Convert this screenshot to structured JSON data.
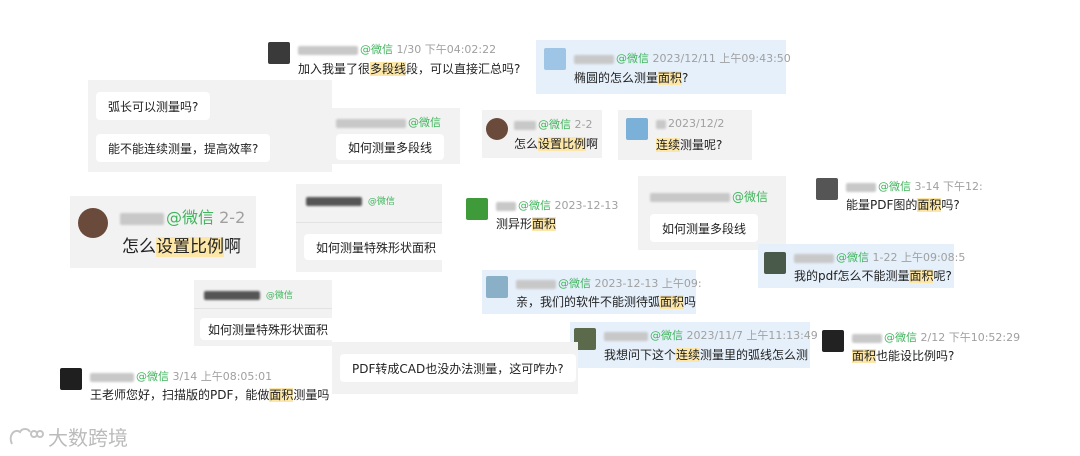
{
  "colors": {
    "wechat_green": "#3fb55c",
    "highlight": "#fde7a8",
    "blue_card": "#e6f0fb",
    "gray_card": "#f2f2f2"
  },
  "messages": {
    "m1": {
      "app": "@微信",
      "time": "1/30 下午04:02:22",
      "text_a": "加入我量了很",
      "text_hl": "多段线",
      "text_b": "段，可以直接汇总吗?"
    },
    "m2": {
      "app": "@微信",
      "time": "2023/12/11 上午09:43:50",
      "text_a": "椭圆的怎么测量",
      "text_hl": "面积",
      "text_b": "?"
    },
    "m3": {
      "bubble1": "弧长可以测量吗?",
      "bubble2": "能不能连续测量，提高效率?"
    },
    "m4": {
      "app": "@微信",
      "bubble": "如何测量多段线"
    },
    "m5": {
      "app": "@微信",
      "time": "2-2",
      "text_a": "怎么",
      "text_hl": "设置比例",
      "text_b": "啊"
    },
    "m6": {
      "time": "2023/12/2",
      "text_hl": "连续",
      "text_b": "测量呢?"
    },
    "m7": {
      "app": "@微信",
      "time": "2-2",
      "text_a": "怎么",
      "text_hl": "设置比例",
      "text_b": "啊"
    },
    "m8": {
      "app": "@微信",
      "bubble": "如何测量特殊形状面积"
    },
    "m9": {
      "app": "@微信",
      "time": "2023-12-13",
      "text_a": "测异形",
      "text_hl": "面积",
      "text_b": ""
    },
    "m10": {
      "app": "@微信",
      "bubble": "如何测量多段线"
    },
    "m11": {
      "app": "@微信",
      "time": "3-14 下午12:",
      "text_a": "能量PDF图的",
      "text_hl": "面积",
      "text_b": "吗?"
    },
    "m12": {
      "app": "@微信",
      "time": "1-22 上午09:08:5",
      "text_a": "我的pdf怎么不能测量",
      "text_hl": "面积",
      "text_b": "呢?"
    },
    "m13": {
      "app": "@微信",
      "time": "2023-12-13 上午09:",
      "text_a": "亲，我们的软件不能测待弧",
      "text_hl": "面积",
      "text_b": "吗"
    },
    "m14": {
      "app": "@微信",
      "bubble": "如何测量特殊形状面积"
    },
    "m15": {
      "app": "@微信",
      "time": "2023/11/7 上午11:13:49",
      "text_a": "我想问下这个",
      "text_hl": "连续",
      "text_b": "测量里的弧线怎么测"
    },
    "m16": {
      "app": "@微信",
      "time": "2/12 下午10:52:29",
      "text_a": "",
      "text_hl": "面积",
      "text_b": "也能设比例吗?"
    },
    "m17": {
      "app": "@微信",
      "time": "3/14 上午08:05:01",
      "text_a": "王老师您好，扫描版的PDF，能做",
      "text_hl": "面积",
      "text_b": "测量吗"
    },
    "m18": {
      "bubble": "PDF转成CAD也没办法测量，这可咋办?"
    }
  },
  "watermark": {
    "logo_text": "大数跨境"
  }
}
